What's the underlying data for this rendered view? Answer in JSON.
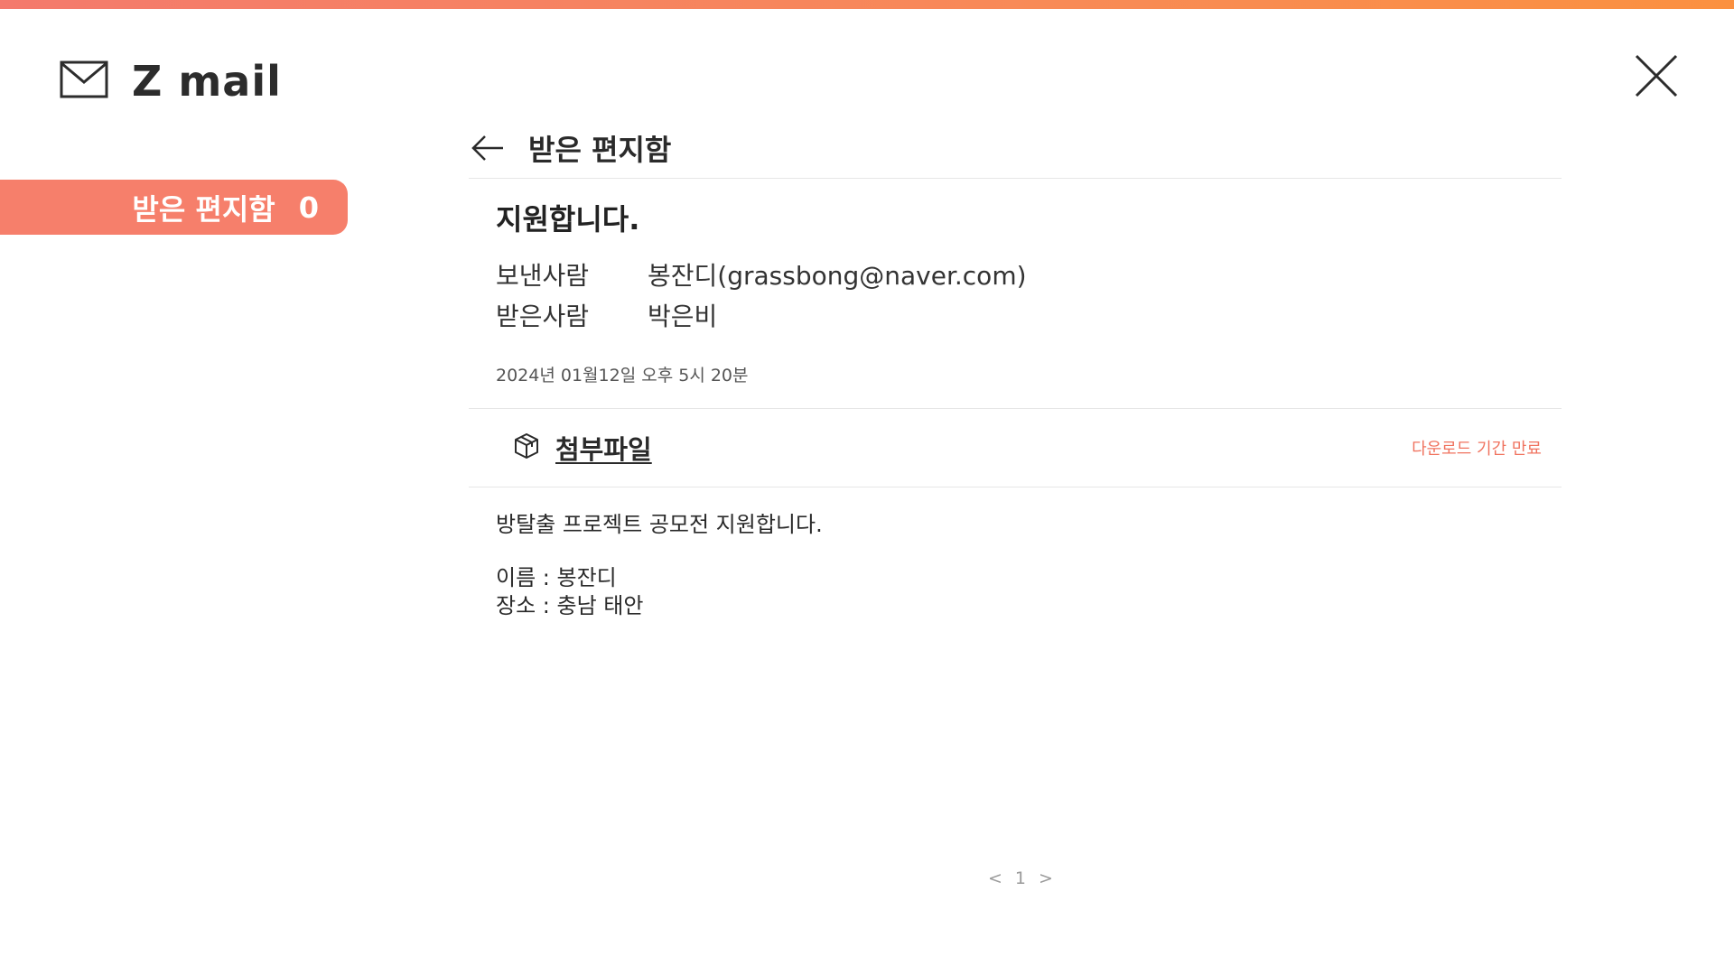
{
  "app": {
    "title": "Z mail"
  },
  "sidebar": {
    "active_label": "받은 편지함",
    "active_count": "0"
  },
  "header": {
    "title": "받은 편지함"
  },
  "mail": {
    "subject": "지원합니다.",
    "from_label": "보낸사람",
    "from_value": "봉잔디(grassbong@naver.com)",
    "to_label": "받은사람",
    "to_value": "박은비",
    "date": "2024년 01월12일 오후 5시 20분",
    "attachment_label": "첨부파일",
    "attachment_status": "다운로드 기간 만료",
    "body_line1": "방탈출 프로젝트 공모전 지원합니다.",
    "body_line2": "이름 : 봉잔디",
    "body_line3": "장소 : 충남 태안"
  },
  "pagination": {
    "prev": "<",
    "current": "1",
    "next": ">"
  },
  "colors": {
    "accent": "#f67f6b",
    "warning": "#f0735f"
  },
  "icons": {
    "brand": "envelope-icon",
    "close": "close-icon",
    "back": "arrow-left-icon",
    "attachment": "box-icon"
  }
}
